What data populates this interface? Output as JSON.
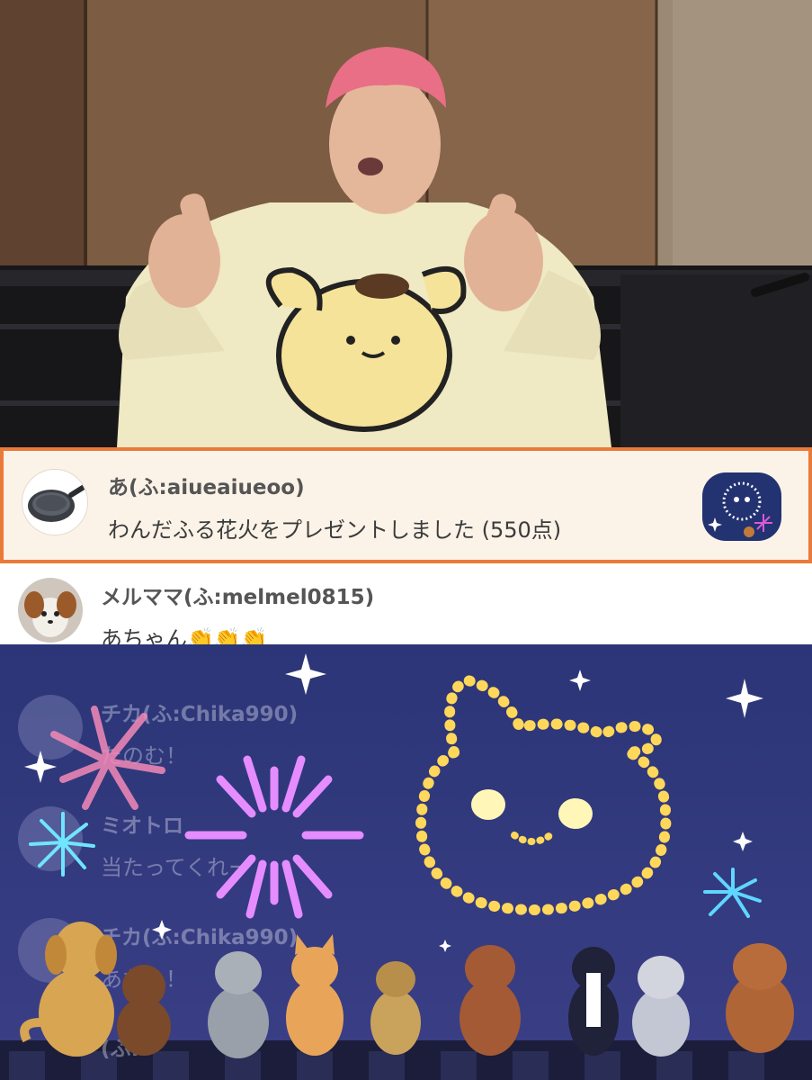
{
  "stream": {
    "gift_comment": {
      "username": "あ(ふ:aiueaiueoo)",
      "message": "わんだふる花火をプレゼントしました (550点)",
      "avatar_icon": "frying-pan-icon",
      "gift_icon": "wonderful-fireworks-gift-icon"
    },
    "comments": [
      {
        "username": "メルママ(ふ:melmel0815)",
        "message": "あちゃん👏👏👏",
        "avatar_icon": "dog-photo-avatar"
      }
    ],
    "obscured_comments": [
      {
        "username": "チカ(ふ:Chika990)",
        "message": "たのむ！"
      },
      {
        "username": "ミオトロ",
        "message": "当たってくれー"
      },
      {
        "username": "チカ(ふ:Chika990)",
        "message": "あたれ！"
      },
      {
        "username": "(ふ:",
        "message": ""
      }
    ]
  },
  "colors": {
    "gift_highlight_border": "#ea7a3a",
    "gift_highlight_bg": "#fbf3e8",
    "fireworks_sky": "#2e3a78"
  }
}
